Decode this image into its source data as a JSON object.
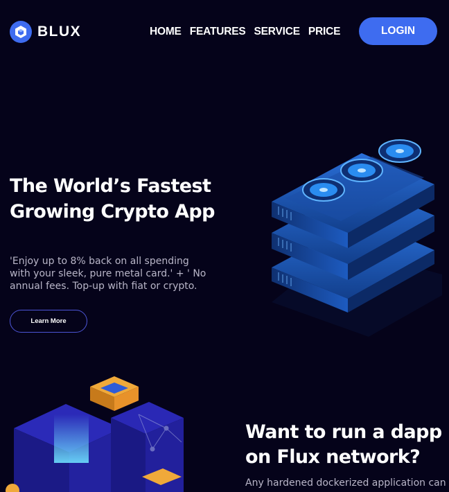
{
  "brand": {
    "name": "BLUX",
    "logo_icon": "hexagon-cube-icon",
    "accent": "#3e6cf0"
  },
  "nav": {
    "items": [
      {
        "label": "HOME"
      },
      {
        "label": "FEATURES"
      },
      {
        "label": "SERVICE"
      },
      {
        "label": "PRICE"
      }
    ],
    "login_label": "LOGIN"
  },
  "hero": {
    "title": "The World’s Fastest Growing Crypto App",
    "description": "'Enjoy up to 8% back on all spending with your sleek, pure metal card.' + ' No annual fees. Top-up with fiat or crypto.",
    "cta_label": "Learn More",
    "illustration": "gpu-mining-rig-illustration"
  },
  "section2": {
    "title": "Want to run a dapp on Flux network?",
    "description": "Any hardened dockerized application can",
    "illustration": "isometric-blocks-illustration"
  },
  "colors": {
    "background": "#05031a",
    "muted_text": "#b9b6c8",
    "button_border": "#4d56d8"
  }
}
